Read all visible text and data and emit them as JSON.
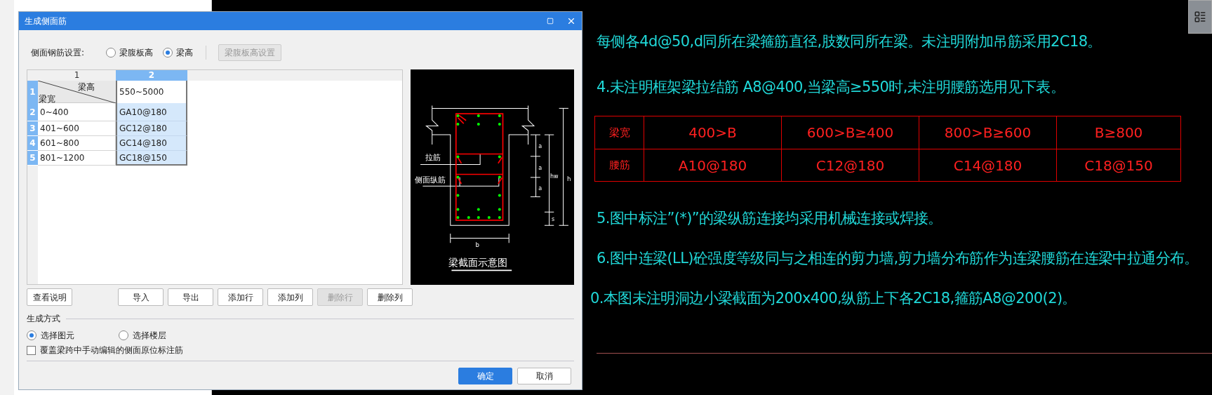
{
  "dialog": {
    "title": "生成侧面筋",
    "settings_label": "侧面钢筋设置:",
    "height_options": [
      {
        "label": "梁腹板高",
        "selected": false
      },
      {
        "label": "梁高",
        "selected": true
      }
    ],
    "web_height_button": {
      "label": "梁腹板高设置",
      "disabled": true
    },
    "grid": {
      "column_headers": [
        {
          "label": "1",
          "selected": false
        },
        {
          "label": "2",
          "selected": true
        }
      ],
      "corner": {
        "top": "梁高",
        "bottom": "梁宽"
      },
      "header_row": {
        "number": "1",
        "selected": true,
        "value": "550~5000",
        "value_selected": false
      },
      "rows": [
        {
          "number": "2",
          "selected": true,
          "width_range": "0~400",
          "value": "GA10@180",
          "value_selected": true
        },
        {
          "number": "3",
          "selected": true,
          "width_range": "401~600",
          "value": "GC12@180",
          "value_selected": true
        },
        {
          "number": "4",
          "selected": true,
          "width_range": "601~800",
          "value": "GC14@180",
          "value_selected": true
        },
        {
          "number": "5",
          "selected": true,
          "width_range": "801~1200",
          "value": "GC18@150",
          "value_selected": true
        }
      ]
    },
    "diagram": {
      "tie_label": "拉筋",
      "side_bar_label": "侧面纵筋",
      "a_labels": [
        "a",
        "a",
        "a"
      ],
      "hw": "hw",
      "h": "h",
      "s": "s",
      "b": "b",
      "caption": "梁截面示意图"
    },
    "buttons": [
      {
        "label": "查看说明",
        "disabled": false
      },
      {
        "label": "导入",
        "disabled": false
      },
      {
        "label": "导出",
        "disabled": false
      },
      {
        "label": "添加行",
        "disabled": false
      },
      {
        "label": "添加列",
        "disabled": false
      },
      {
        "label": "删除行",
        "disabled": true
      },
      {
        "label": "删除列",
        "disabled": false
      }
    ],
    "generation": {
      "title": "生成方式",
      "options": [
        {
          "label": "选择图元",
          "selected": true
        },
        {
          "label": "选择楼层",
          "selected": false
        }
      ],
      "override": {
        "label": "覆盖梁跨中手动编辑的侧面原位标注筋",
        "checked": false
      }
    },
    "footer_buttons": [
      {
        "label": "确定",
        "primary": true
      },
      {
        "label": "取消",
        "primary": false
      }
    ]
  },
  "cad": {
    "notes_before": [
      "每侧各4d@50,d同所在梁箍筋直径,肢数同所在梁。未注明附加吊筋采用2C18。",
      "4.未注明框架梁拉结筋 A8@400,当梁高≥550时,未注明腰筋选用见下表。"
    ],
    "table": [
      {
        "header": "梁宽",
        "cells": [
          "400>B",
          "600>B≥400",
          "800>B≥600",
          "B≥800"
        ]
      },
      {
        "header": "腰筋",
        "cells": [
          "A10@180",
          "C12@180",
          "C14@180",
          "C18@150"
        ]
      }
    ],
    "notes_after": [
      "5.图中标注”(*)”的梁纵筋连接均采用机械连接或焊接。",
      "6.图中连梁(LL)砼强度等级同与之相连的剪力墙,剪力墙分布筋作为连梁腰筋在连梁中拉通分布。",
      "0.本图未注明洞边小梁截面为200x400,纵筋上下各2C18,箍筋A8@200(2)。"
    ]
  }
}
